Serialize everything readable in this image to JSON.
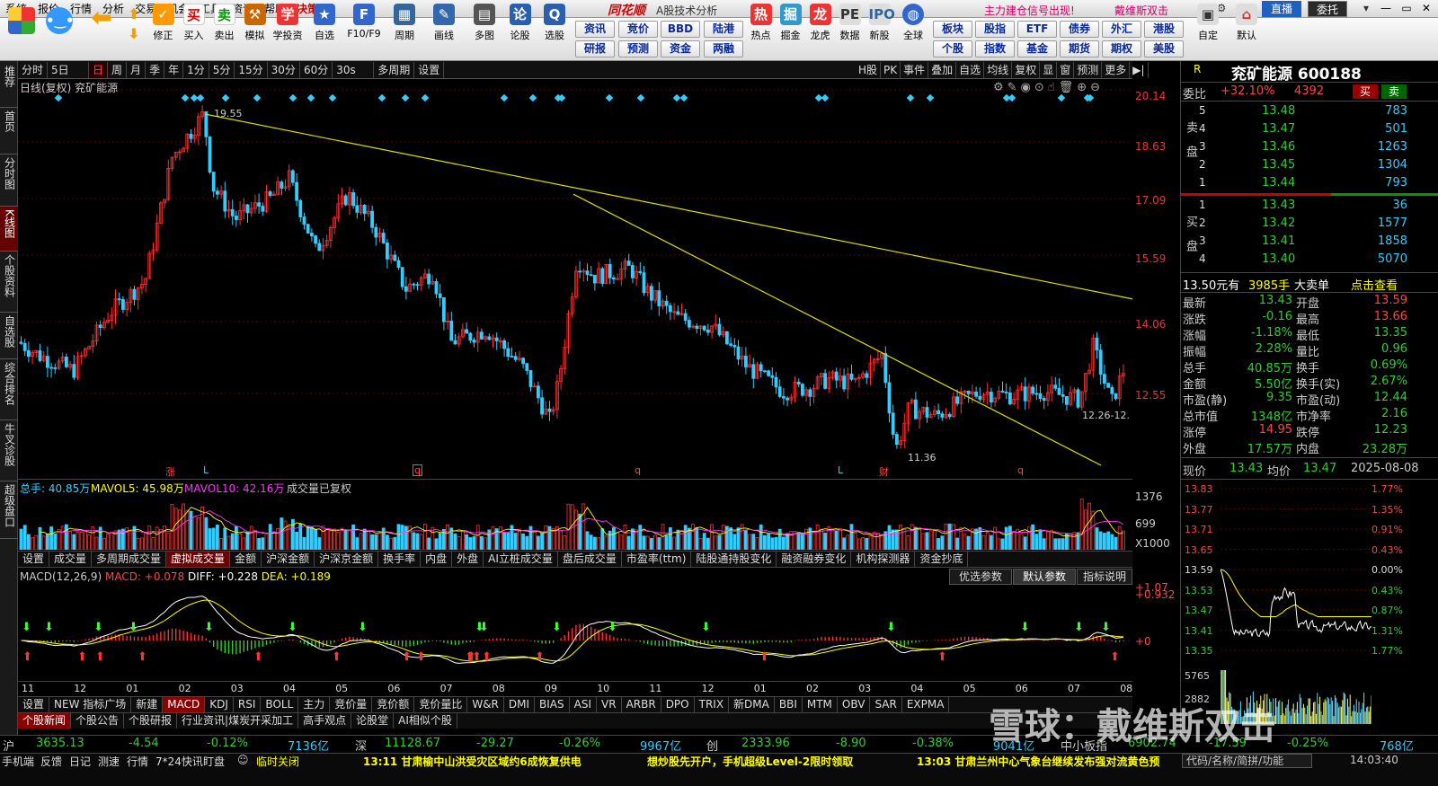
{
  "menubar": {
    "items": [
      "系统",
      "报价",
      "行情",
      "分析",
      "交易",
      "机会",
      "工具",
      "资讯",
      "帮助",
      "决策"
    ],
    "logo": "同花顺",
    "app_title": "A股技术分析",
    "news1": "主力建仓信号出现!",
    "news2": "戴维斯双击",
    "live": "直播",
    "trade": "委托"
  },
  "toolbar": {
    "icons": [
      "修正",
      "买入",
      "卖出",
      "模拟",
      "学投资",
      "自选",
      "F10/F9",
      "周期",
      "画线",
      "多图",
      "论股",
      "选股",
      "热点",
      "掘金",
      "龙虎",
      "数据",
      "新股",
      "全球",
      "自定",
      "默认"
    ],
    "btn_grid": [
      [
        "资讯",
        "竞价",
        "BBD",
        "陆港"
      ],
      [
        "研报",
        "预测",
        "资金",
        "两融"
      ]
    ],
    "btn_grid2": [
      [
        "板块",
        "股指",
        "ETF",
        "债券",
        "外汇",
        "港股"
      ],
      [
        "个股",
        "指数",
        "基金",
        "期货",
        "期权",
        "美股"
      ]
    ]
  },
  "leftnav": [
    "推荐",
    "首页",
    "分时图",
    "K线图",
    "个股资料",
    "自选股",
    "综合排名",
    "牛叉诊股",
    "超级盘口"
  ],
  "periodbar": {
    "items": [
      "分时",
      "5日",
      "日",
      "周",
      "月",
      "季",
      "年",
      "1分",
      "5分",
      "15分",
      "30分",
      "60分",
      "30s",
      "多周期",
      "设置"
    ],
    "active": "日",
    "right": [
      "H股",
      "PK",
      "事件",
      "叠加",
      "自选",
      "均线",
      "复权",
      "显",
      "窗",
      "预测",
      "更多"
    ]
  },
  "chart": {
    "title": "日线(复权)  兖矿能源",
    "y_labels": [
      "20.14",
      "18.63",
      "17.09",
      "15.59",
      "14.06",
      "12.55"
    ],
    "high_label": "19.55",
    "low_label": "11.36",
    "last_label": "12.26-12.",
    "markers": [
      "涨",
      "L",
      "q",
      "q",
      "L",
      "财",
      "q"
    ]
  },
  "volume": {
    "label": "总手: 40.85万",
    "ma5": "MAVOL5: 45.98万",
    "ma10": "MAVOL10: 42.16万",
    "note": "成交量已复权",
    "y_labels": [
      "1376",
      "699",
      "X1000"
    ]
  },
  "tabs1": [
    "设置",
    "成交量",
    "多周期成交量",
    "虚拟成交量",
    "金额",
    "沪深金额",
    "沪深京金额",
    "换手率",
    "内盘",
    "外盘",
    "AI立桩成交量",
    "盘后成交量",
    "市盈率(ttm)",
    "陆股通持股变化",
    "融资融券变化",
    "机构探测器",
    "资金抄底"
  ],
  "tabs1_active": "虚拟成交量",
  "macd": {
    "name": "MACD(12,26,9)",
    "macd": "MACD: +0.078",
    "diff": "DIFF: +0.228",
    "dea": "DEA: +0.189",
    "y_labels": [
      "+1.07",
      "+0.932",
      "+0"
    ],
    "buttons": [
      "优选参数",
      "默认参数",
      "指标说明"
    ]
  },
  "xaxis": [
    "11",
    "12",
    "01",
    "02",
    "03",
    "04",
    "05",
    "06",
    "07",
    "08",
    "09",
    "10",
    "11",
    "12",
    "01",
    "02",
    "03",
    "04",
    "05",
    "06",
    "07",
    "08"
  ],
  "tabs2": [
    "设置",
    "NEW 指标广场",
    "新建",
    "MACD",
    "KDJ",
    "RSI",
    "BOLL",
    "主力",
    "竞价量",
    "竞价额",
    "竞价量比",
    "W&R",
    "DMI",
    "BIAS",
    "ASI",
    "VR",
    "ARBR",
    "DPO",
    "TRIX",
    "新DMA",
    "BBI",
    "MTM",
    "OBV",
    "SAR",
    "EXPMA"
  ],
  "tabs2_active": "MACD",
  "tabs3": [
    "个股新闻",
    "个股公告",
    "个股研报",
    "行业资讯|煤炭开采加工",
    "高手观点",
    "论股堂",
    "AI相似个股"
  ],
  "tabs3_active": "个股新闻",
  "rpanel": {
    "code": "R",
    "name": "兖矿能源 600188",
    "weibi_label": "委比",
    "weibi": "+32.10%",
    "weicha": "4392",
    "buy": "买",
    "sell": "卖",
    "asks": [
      [
        "5",
        "13.48",
        "783"
      ],
      [
        "4",
        "13.47",
        "501"
      ],
      [
        "3",
        "13.46",
        "1263"
      ],
      [
        "2",
        "13.45",
        "1304"
      ],
      [
        "1",
        "13.44",
        "793"
      ]
    ],
    "bids": [
      [
        "1",
        "13.43",
        "36"
      ],
      [
        "2",
        "13.42",
        "1577"
      ],
      [
        "3",
        "13.41",
        "1858"
      ],
      [
        "4",
        "13.40",
        "5070"
      ]
    ],
    "ask_label": "卖盘",
    "bid_label": "买盘",
    "bigorder": "13.50元有",
    "bigorder_qty": "3985手",
    "bigorder_txt": "大卖单",
    "bigorder_link": "点击查看",
    "quote": [
      [
        "最新",
        "13.43",
        "开盘",
        "13.59"
      ],
      [
        "涨跌",
        "-0.16",
        "最高",
        "13.66"
      ],
      [
        "涨幅",
        "-1.18%",
        "最低",
        "13.35"
      ],
      [
        "振幅",
        "2.28%",
        "量比",
        "0.96"
      ],
      [
        "总手",
        "40.85万",
        "换手",
        "0.69%"
      ],
      [
        "金额",
        "5.50亿",
        "换手(实)",
        "2.67%"
      ],
      [
        "市盈(静)",
        "9.35",
        "市盈(动)",
        "12.44"
      ],
      [
        "总市值",
        "1348亿",
        "市净率",
        "2.16"
      ],
      [
        "涨停",
        "14.95",
        "跌停",
        "12.23"
      ],
      [
        "外盘",
        "17.57万",
        "内盘",
        "23.28万"
      ]
    ],
    "mini": {
      "now_label": "现价",
      "now": "13.43",
      "avg_label": "均价",
      "avg": "13.47",
      "date": "2025-08-08",
      "left": [
        "13.83",
        "13.77",
        "13.71",
        "13.65",
        "13.59",
        "13.53",
        "13.47",
        "13.41",
        "13.35",
        "5765",
        "2882"
      ],
      "right": [
        "1.77%",
        "1.35%",
        "0.91%",
        "0.43%",
        "0.00%",
        "0.43%",
        "0.87%",
        "1.31%",
        "1.77%"
      ]
    }
  },
  "index": {
    "sh_label": "沪",
    "sh": "3635.13",
    "sh_chg": "-4.54",
    "sh_pct": "-0.12%",
    "sh_amt": "7136亿",
    "sz_label": "深",
    "sz": "11128.67",
    "sz_chg": "-29.27",
    "sz_pct": "-0.26%",
    "sz_amt": "9967亿",
    "cy_label": "创",
    "cy": "2333.96",
    "cy_chg": "-8.90",
    "cy_pct": "-0.38%",
    "cy_amt": "9041亿",
    "zxb_label": "中小板指",
    "zxb": "6902.74",
    "zxb_chg": "-17.59",
    "zxb_pct": "-0.25%",
    "zxb_amt": "768亿"
  },
  "status": {
    "items": [
      "手机端",
      "反馈",
      "日记",
      "测速",
      "行情",
      "7*24快讯",
      "盯盘",
      "临时关闭"
    ],
    "news1": "13:11 甘肃榆中山洪受灾区域约6成恢复供电",
    "news2": "想炒股先开户，手机超级Level-2限时领取",
    "news3": "13:03 甘肃兰州中心气象台继续发布强对流黄色预",
    "search": "代码/名称/简拼/功能",
    "time": "14:03:40"
  },
  "watermark": "雪球：戴维斯双击"
}
